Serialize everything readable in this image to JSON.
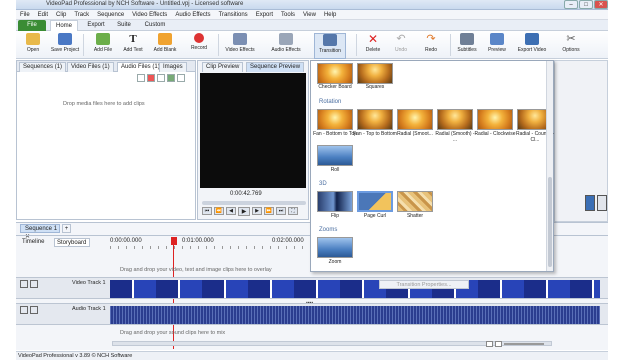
{
  "window": {
    "title": "VideoPad Professional by NCH Software - Untitled.vpj - Licensed software"
  },
  "menu": [
    "File",
    "Edit",
    "Clip",
    "Track",
    "Sequence",
    "Video Effects",
    "Audio Effects",
    "Transitions",
    "Export",
    "Tools",
    "View",
    "Help"
  ],
  "ribbon_tabs": [
    "File",
    "Home",
    "Export",
    "Suite",
    "Custom"
  ],
  "ribbon_buttons": [
    "Open",
    "Save Project",
    "Add File",
    "Add Text",
    "Add Blank",
    "Record",
    "Video Effects",
    "Audio Effects",
    "Transition",
    "Delete",
    "Undo",
    "Redo",
    "Subtitles",
    "Preview",
    "Export Video",
    "Options"
  ],
  "bin": {
    "tabs": [
      "Sequences",
      "Video Files",
      "Audio Files",
      "Images"
    ],
    "tab_counts": [
      "(1)",
      "(1)",
      "(1)"
    ],
    "empty_hint": "Drop media files here to add clips"
  },
  "preview": {
    "tabs": [
      "Clip Preview",
      "Sequence Preview"
    ],
    "time": "0:00:42.769"
  },
  "transitions": {
    "top_row": [
      "Checker Board",
      "Squares"
    ],
    "sections": [
      {
        "title": "Rotation",
        "items": [
          "Fan - Bottom to Top",
          "Fan - Top to Bottom",
          "Radial (Smoot...",
          "Radial (Smooth) - ...",
          "Radial - Clockwise",
          "Radial - Counter-Cl...",
          "Roll"
        ]
      },
      {
        "title": "3D",
        "items": [
          "Flip",
          "Page Curl",
          "Shatter"
        ]
      },
      {
        "title": "Zooms",
        "items": [
          "Zoom"
        ]
      }
    ],
    "properties_button": "Transition Properties..."
  },
  "timeline": {
    "sequence_tab": "Sequence 1",
    "add_tab": "+",
    "views": [
      "Timeline",
      "Storyboard"
    ],
    "ruler": [
      "0:00:00.000",
      "0:01:00.000",
      "0:02:00.000"
    ],
    "overlay_hint": "Drag and drop your video, text and image clips here to overlay",
    "video_track": "Video Track 1",
    "audio_track": "Audio Track 1",
    "audio_hint": "Drag and drop your sound clips here to mix"
  },
  "status": "VideoPad Professional v 3.89 © NCH Software"
}
